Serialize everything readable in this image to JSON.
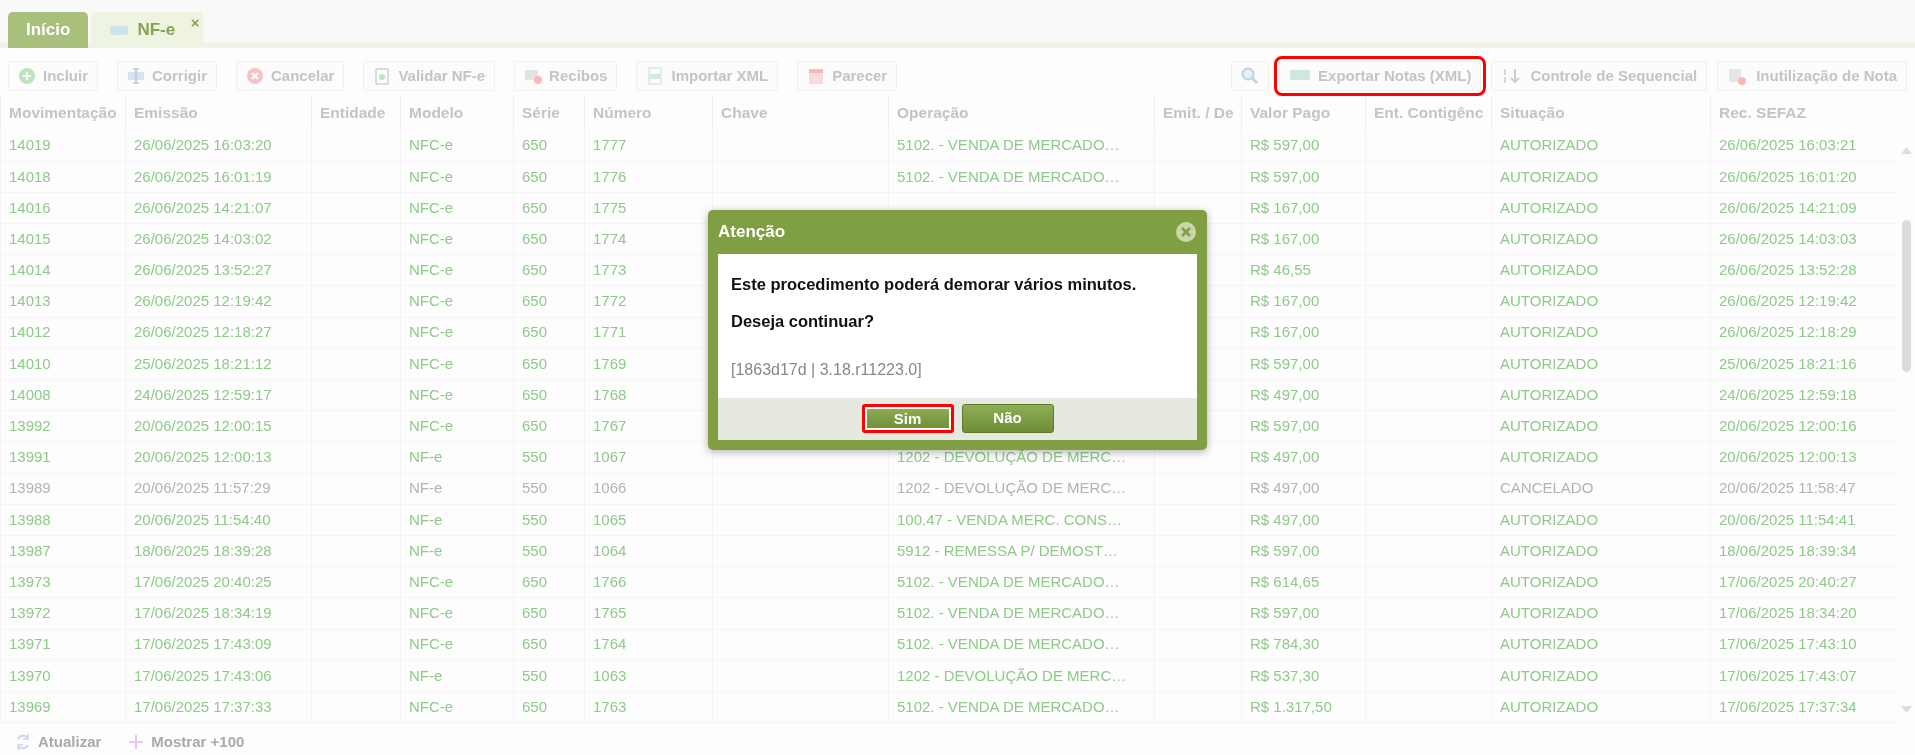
{
  "tabs": [
    {
      "label": "Início",
      "selected": false
    },
    {
      "label": "NF-e",
      "selected": true,
      "close": "×"
    }
  ],
  "toolbar_left": [
    {
      "label": "Incluir"
    },
    {
      "label": "Corrigir"
    },
    {
      "label": "Cancelar"
    },
    {
      "label": "Validar NF-e"
    },
    {
      "label": "Recibos"
    },
    {
      "label": "Importar XML"
    },
    {
      "label": "Parecer"
    }
  ],
  "toolbar_right": [
    {
      "label": "Exportar Notas (XML)",
      "highlighted": true
    },
    {
      "label": "Controle de Sequencial",
      "highlighted": false
    },
    {
      "label": "Inutilização de Nota",
      "highlighted": false
    }
  ],
  "table": {
    "columns": [
      "Movimentação",
      "Emissão",
      "Entidade",
      "Modelo",
      "Série",
      "Número",
      "Chave",
      "Operação",
      "Emit. / De",
      "Valor Pago",
      "Ent. Contigênc",
      "Situação",
      "Rec. SEFAZ"
    ],
    "rows": [
      {
        "mov": "14019",
        "emissao": "26/06/2025 16:03:20",
        "modelo": "NFC-e",
        "serie": "650",
        "numero": "1777",
        "operacao": "5102. - VENDA DE MERCADO…",
        "valor": "R$ 597,00",
        "situacao": "AUTORIZADO",
        "rec": "26/06/2025 16:03:21",
        "cancelled": false
      },
      {
        "mov": "14018",
        "emissao": "26/06/2025 16:01:19",
        "modelo": "NFC-e",
        "serie": "650",
        "numero": "1776",
        "operacao": "5102. - VENDA DE MERCADO…",
        "valor": "R$ 597,00",
        "situacao": "AUTORIZADO",
        "rec": "26/06/2025 16:01:20",
        "cancelled": false
      },
      {
        "mov": "14016",
        "emissao": "26/06/2025 14:21:07",
        "modelo": "NFC-e",
        "serie": "650",
        "numero": "1775",
        "valor": "R$ 167,00",
        "situacao": "AUTORIZADO",
        "rec": "26/06/2025 14:21:09",
        "cancelled": false
      },
      {
        "mov": "14015",
        "emissao": "26/06/2025 14:03:02",
        "modelo": "NFC-e",
        "serie": "650",
        "numero": "1774",
        "valor": "R$ 167,00",
        "situacao": "AUTORIZADO",
        "rec": "26/06/2025 14:03:03",
        "cancelled": false
      },
      {
        "mov": "14014",
        "emissao": "26/06/2025 13:52:27",
        "modelo": "NFC-e",
        "serie": "650",
        "numero": "1773",
        "valor": "R$ 46,55",
        "situacao": "AUTORIZADO",
        "rec": "26/06/2025 13:52:28",
        "cancelled": false
      },
      {
        "mov": "14013",
        "emissao": "26/06/2025 12:19:42",
        "modelo": "NFC-e",
        "serie": "650",
        "numero": "1772",
        "valor": "R$ 167,00",
        "situacao": "AUTORIZADO",
        "rec": "26/06/2025 12:19:42",
        "cancelled": false
      },
      {
        "mov": "14012",
        "emissao": "26/06/2025 12:18:27",
        "modelo": "NFC-e",
        "serie": "650",
        "numero": "1771",
        "valor": "R$ 167,00",
        "situacao": "AUTORIZADO",
        "rec": "26/06/2025 12:18:29",
        "cancelled": false
      },
      {
        "mov": "14010",
        "emissao": "25/06/2025 18:21:12",
        "modelo": "NFC-e",
        "serie": "650",
        "numero": "1769",
        "valor": "R$ 597,00",
        "situacao": "AUTORIZADO",
        "rec": "25/06/2025 18:21:16",
        "cancelled": false
      },
      {
        "mov": "14008",
        "emissao": "24/06/2025 12:59:17",
        "modelo": "NFC-e",
        "serie": "650",
        "numero": "1768",
        "valor": "R$ 497,00",
        "situacao": "AUTORIZADO",
        "rec": "24/06/2025 12:59:18",
        "cancelled": false
      },
      {
        "mov": "13992",
        "emissao": "20/06/2025 12:00:15",
        "modelo": "NFC-e",
        "serie": "650",
        "numero": "1767",
        "valor": "R$ 597,00",
        "situacao": "AUTORIZADO",
        "rec": "20/06/2025 12:00:16",
        "cancelled": false
      },
      {
        "mov": "13991",
        "emissao": "20/06/2025 12:00:13",
        "modelo": "NF-e",
        "serie": "550",
        "numero": "1067",
        "operacao": "1202 - DEVOLUÇÃO DE MERC…",
        "valor": "R$ 497,00",
        "situacao": "AUTORIZADO",
        "rec": "20/06/2025 12:00:13",
        "cancelled": false
      },
      {
        "mov": "13989",
        "emissao": "20/06/2025 11:57:29",
        "modelo": "NF-e",
        "serie": "550",
        "numero": "1066",
        "operacao": "1202 - DEVOLUÇÃO DE MERC…",
        "valor": "R$ 497,00",
        "situacao": "CANCELADO",
        "rec": "20/06/2025 11:58:47",
        "cancelled": true
      },
      {
        "mov": "13988",
        "emissao": "20/06/2025 11:54:40",
        "modelo": "NF-e",
        "serie": "550",
        "numero": "1065",
        "operacao": "100.47 - VENDA MERC. CONS…",
        "valor": "R$ 497,00",
        "situacao": "AUTORIZADO",
        "rec": "20/06/2025 11:54:41",
        "cancelled": false
      },
      {
        "mov": "13987",
        "emissao": "18/06/2025 18:39:28",
        "modelo": "NF-e",
        "serie": "550",
        "numero": "1064",
        "operacao": "5912 - REMESSA P/ DEMOST…",
        "valor": "R$ 597,00",
        "situacao": "AUTORIZADO",
        "rec": "18/06/2025 18:39:34",
        "cancelled": false
      },
      {
        "mov": "13973",
        "emissao": "17/06/2025 20:40:25",
        "modelo": "NFC-e",
        "serie": "650",
        "numero": "1766",
        "operacao": "5102. - VENDA DE MERCADO…",
        "valor": "R$ 614,65",
        "situacao": "AUTORIZADO",
        "rec": "17/06/2025 20:40:27",
        "cancelled": false
      },
      {
        "mov": "13972",
        "emissao": "17/06/2025 18:34:19",
        "modelo": "NFC-e",
        "serie": "650",
        "numero": "1765",
        "operacao": "5102. - VENDA DE MERCADO…",
        "valor": "R$ 597,00",
        "situacao": "AUTORIZADO",
        "rec": "17/06/2025 18:34:20",
        "cancelled": false
      },
      {
        "mov": "13971",
        "emissao": "17/06/2025 17:43:09",
        "modelo": "NFC-e",
        "serie": "650",
        "numero": "1764",
        "operacao": "5102. - VENDA DE MERCADO…",
        "valor": "R$ 784,30",
        "situacao": "AUTORIZADO",
        "rec": "17/06/2025 17:43:10",
        "cancelled": false
      },
      {
        "mov": "13970",
        "emissao": "17/06/2025 17:43:06",
        "modelo": "NF-e",
        "serie": "550",
        "numero": "1063",
        "operacao": "1202 - DEVOLUÇÃO DE MERC…",
        "valor": "R$ 537,30",
        "situacao": "AUTORIZADO",
        "rec": "17/06/2025 17:43:07",
        "cancelled": false
      },
      {
        "mov": "13969",
        "emissao": "17/06/2025 17:37:33",
        "modelo": "NFC-e",
        "serie": "650",
        "numero": "1763",
        "operacao": "5102. - VENDA DE MERCADO…",
        "valor": "R$ 1.317,50",
        "situacao": "AUTORIZADO",
        "rec": "17/06/2025 17:37:34",
        "cancelled": false
      }
    ]
  },
  "footer": [
    {
      "label": "Atualizar"
    },
    {
      "label": "Mostrar +100"
    }
  ],
  "dialog": {
    "title": "Atenção",
    "lines": [
      "Este procedimento poderá demorar vários minutos.",
      "Deseja continuar?"
    ],
    "version": "[1863d17d | 3.18.r11223.0]",
    "buttons": [
      {
        "label": "Sim",
        "highlighted": true
      },
      {
        "label": "Não",
        "highlighted": false
      }
    ]
  }
}
